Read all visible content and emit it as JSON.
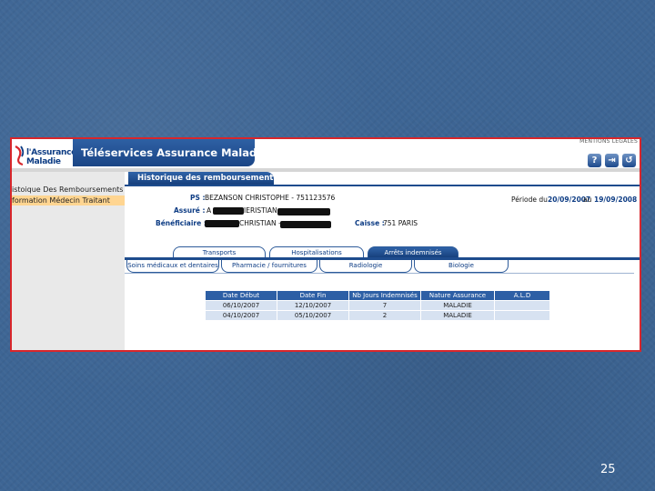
{
  "screenshot": {
    "mentions": "MENTIONS LEGALES",
    "logo": {
      "line1": "l'Assurance",
      "line2": "Maladie"
    },
    "banner_title": "Téléservices Assurance Maladie",
    "icons": [
      {
        "name": "help-icon",
        "glyph": "?"
      },
      {
        "name": "exit-icon",
        "glyph": "⇥"
      },
      {
        "name": "back-icon",
        "glyph": "↺"
      }
    ],
    "sidebar": {
      "items": [
        {
          "label": "istoique Des Remboursements"
        },
        {
          "label": "formation Médecin Traitant"
        }
      ]
    },
    "section_tab": "Historique des remboursements",
    "info": {
      "ps_label": "PS :",
      "ps_value": "BEZANSON CHRISTOPHE - 751123576",
      "periode_label": "Période du",
      "periode_from": "20/09/2007",
      "periode_au": "au",
      "periode_to": "19/09/2008",
      "assure_label": "Assuré :",
      "assure_value": "A",
      "assure_value2": "IERISTIAN -",
      "beneficiaire_label": "Bénéficiaire :",
      "beneficiaire_value": "CHRISTIAN -",
      "caisse_label": "Caisse :",
      "caisse_value": "751 PARIS"
    },
    "tabs_top": [
      {
        "label": "Transports",
        "active": false
      },
      {
        "label": "Hospitalisations",
        "active": false
      },
      {
        "label": "Arrêts indemnisés",
        "active": true
      }
    ],
    "tabs_bottom": [
      {
        "label": "Soins médicaux et dentaires"
      },
      {
        "label": "Pharmacie / fournitures"
      },
      {
        "label": "Radiologie"
      },
      {
        "label": "Biologie"
      }
    ],
    "table": {
      "headers": [
        "Date Début",
        "Date Fin",
        "Nb Jours Indemnisés",
        "Nature Assurance",
        "A.L.D"
      ],
      "rows": [
        [
          "06/10/2007",
          "12/10/2007",
          "7",
          "MALADIE",
          ""
        ],
        [
          "04/10/2007",
          "05/10/2007",
          "2",
          "MALADIE",
          ""
        ]
      ]
    }
  },
  "slide": {
    "page_number": "25"
  }
}
